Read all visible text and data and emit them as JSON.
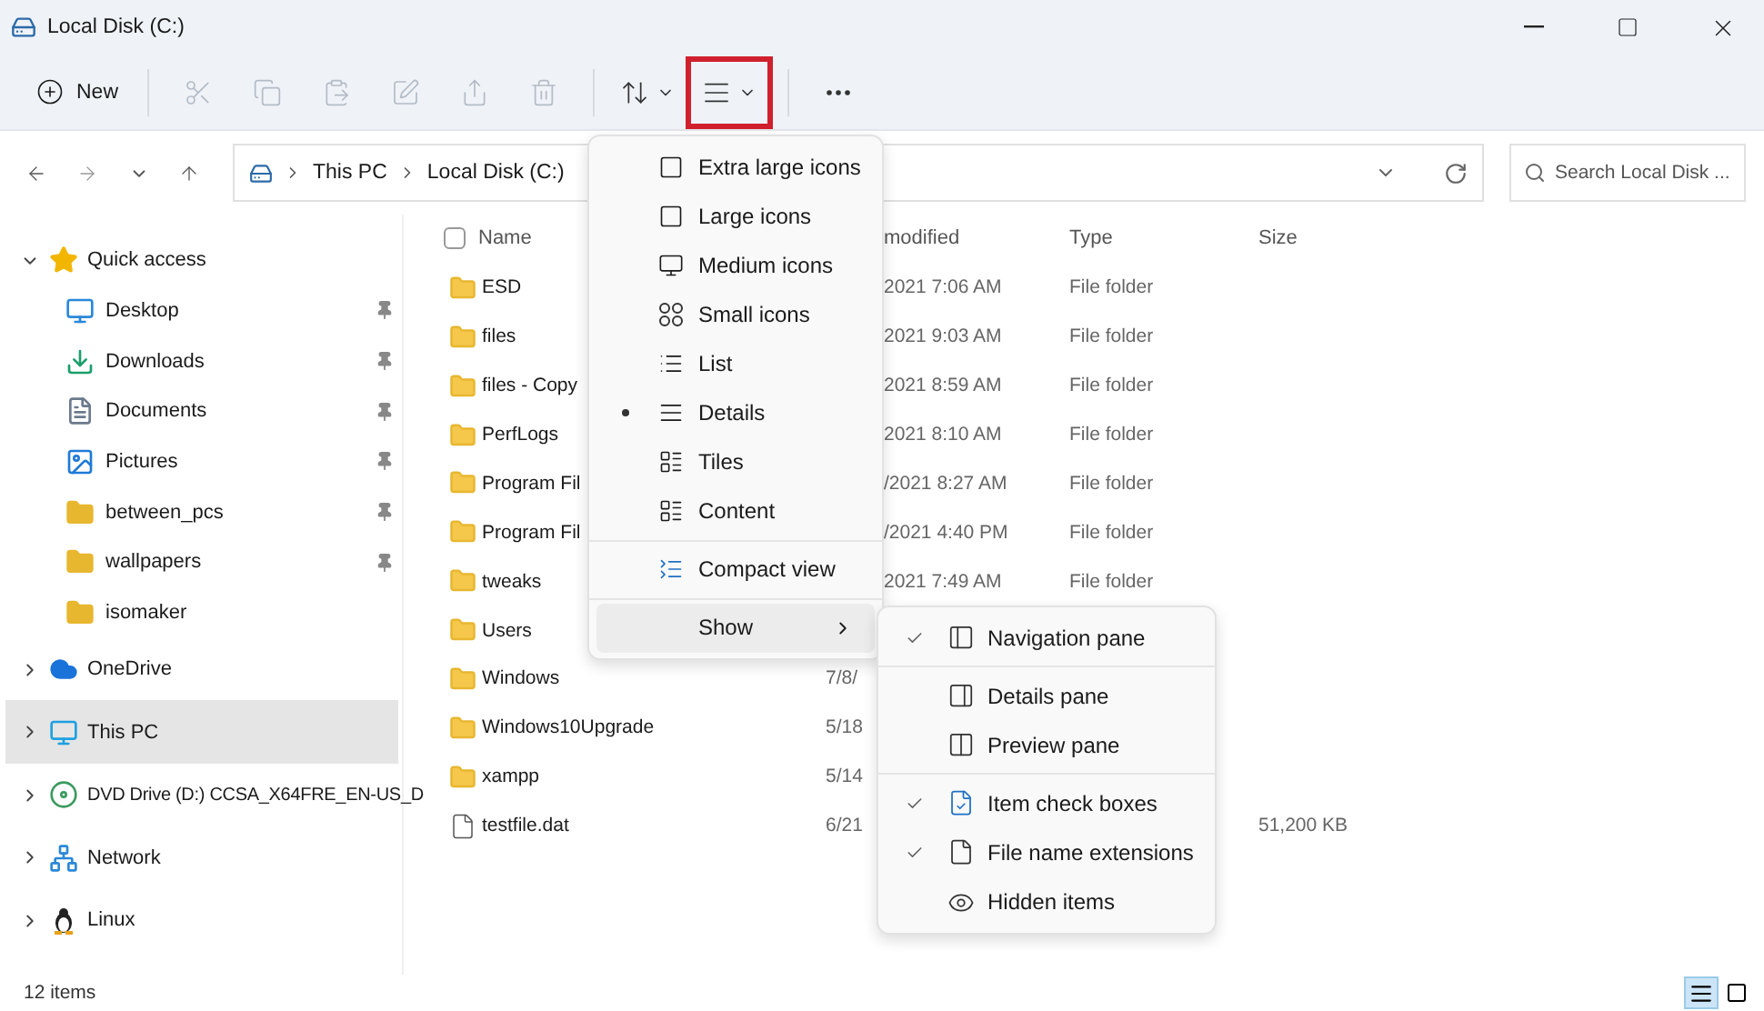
{
  "window": {
    "title": "Local Disk (C:)"
  },
  "toolbar": {
    "new_label": "New",
    "items": [
      {
        "kind": "cut",
        "disabled": true
      },
      {
        "kind": "copy",
        "disabled": true
      },
      {
        "kind": "paste",
        "disabled": true
      },
      {
        "kind": "rename",
        "disabled": true
      },
      {
        "kind": "share",
        "disabled": true
      },
      {
        "kind": "delete",
        "disabled": true
      },
      {
        "kind": "sort",
        "disabled": false
      },
      {
        "kind": "view",
        "disabled": false,
        "highlighted": true
      },
      {
        "kind": "more",
        "disabled": false
      }
    ]
  },
  "address": {
    "crumbs": [
      "This PC",
      "Local Disk (C:)"
    ]
  },
  "search": {
    "placeholder": "Search Local Disk ..."
  },
  "sidebar": {
    "items": [
      {
        "label": "Quick access",
        "kind": "star",
        "expanded": true,
        "selected": false,
        "children": [
          {
            "label": "Desktop",
            "kind": "desktop",
            "pinned": true
          },
          {
            "label": "Downloads",
            "kind": "download",
            "pinned": true
          },
          {
            "label": "Documents",
            "kind": "document",
            "pinned": true
          },
          {
            "label": "Pictures",
            "kind": "picture",
            "pinned": true
          },
          {
            "label": "between_pcs",
            "kind": "folder",
            "pinned": true
          },
          {
            "label": "wallpapers",
            "kind": "folder",
            "pinned": true
          },
          {
            "label": "isomaker",
            "kind": "folder",
            "pinned": false
          }
        ]
      },
      {
        "label": "OneDrive",
        "kind": "cloud",
        "expanded": false,
        "selected": false
      },
      {
        "label": "This PC",
        "kind": "pc",
        "expanded": false,
        "selected": true
      },
      {
        "label": "DVD Drive (D:) CCSA_X64FRE_EN-US_D",
        "kind": "dvd",
        "expanded": false,
        "selected": false
      },
      {
        "label": "Network",
        "kind": "network",
        "expanded": false,
        "selected": false
      },
      {
        "label": "Linux",
        "kind": "penguin",
        "expanded": false,
        "selected": false
      }
    ]
  },
  "table": {
    "select_all": {
      "checked": false
    },
    "columns": [
      "Name",
      "modified",
      "Type",
      "Size"
    ],
    "rows": [
      {
        "name": "ESD",
        "kind": "folder",
        "date": "2021 7:06 AM",
        "type": "File folder"
      },
      {
        "name": "files",
        "kind": "folder",
        "date": "2021 9:03 AM",
        "type": "File folder"
      },
      {
        "name": "files - Copy",
        "kind": "folder",
        "date": "2021 8:59 AM",
        "type": "File folder"
      },
      {
        "name": "PerfLogs",
        "kind": "folder",
        "date": "2021 8:10 AM",
        "type": "File folder"
      },
      {
        "name": "Program Fil",
        "kind": "folder",
        "date": "/2021 8:27 AM",
        "type": "File folder"
      },
      {
        "name": "Program Fil",
        "kind": "folder",
        "date": "/2021 4:40 PM",
        "type": "File folder"
      },
      {
        "name": "tweaks",
        "kind": "folder",
        "date": "2021 7:49 AM",
        "type": "File folder"
      },
      {
        "name": "Users",
        "kind": "folder"
      },
      {
        "name": "Windows",
        "kind": "folder",
        "date": "7/8/"
      },
      {
        "name": "Windows10Upgrade",
        "kind": "folder",
        "date": "5/18"
      },
      {
        "name": "xampp",
        "kind": "folder",
        "date": "5/14"
      },
      {
        "name": "testfile.dat",
        "kind": "file",
        "date": "6/21",
        "size": "51,200 KB"
      }
    ]
  },
  "view_menu": {
    "items": [
      {
        "label": "Extra large icons",
        "kind": "xl",
        "selected": false
      },
      {
        "label": "Large icons",
        "kind": "large",
        "selected": false
      },
      {
        "label": "Medium icons",
        "kind": "medium",
        "selected": false
      },
      {
        "label": "Small icons",
        "kind": "small",
        "selected": false
      },
      {
        "label": "List",
        "kind": "list",
        "selected": false
      },
      {
        "label": "Details",
        "kind": "details",
        "selected": true
      },
      {
        "label": "Tiles",
        "kind": "tiles",
        "selected": false
      },
      {
        "label": "Content",
        "kind": "content",
        "selected": false
      }
    ],
    "compact": "Compact view",
    "show": "Show"
  },
  "show_menu": {
    "items": [
      {
        "label": "Navigation pane",
        "kind": "nav",
        "checked": true
      },
      {
        "label": "Details pane",
        "kind": "details",
        "checked": false
      },
      {
        "label": "Preview pane",
        "kind": "preview",
        "checked": false
      },
      {
        "label": "Item check boxes",
        "kind": "checkboxes",
        "checked": true
      },
      {
        "label": "File name extensions",
        "kind": "extensions",
        "checked": true
      },
      {
        "label": "Hidden items",
        "kind": "hidden",
        "checked": false
      }
    ]
  },
  "status_bar": {
    "count": "12 items",
    "views": [
      {
        "kind": "details",
        "selected": true
      },
      {
        "kind": "tiles",
        "selected": false
      }
    ]
  }
}
